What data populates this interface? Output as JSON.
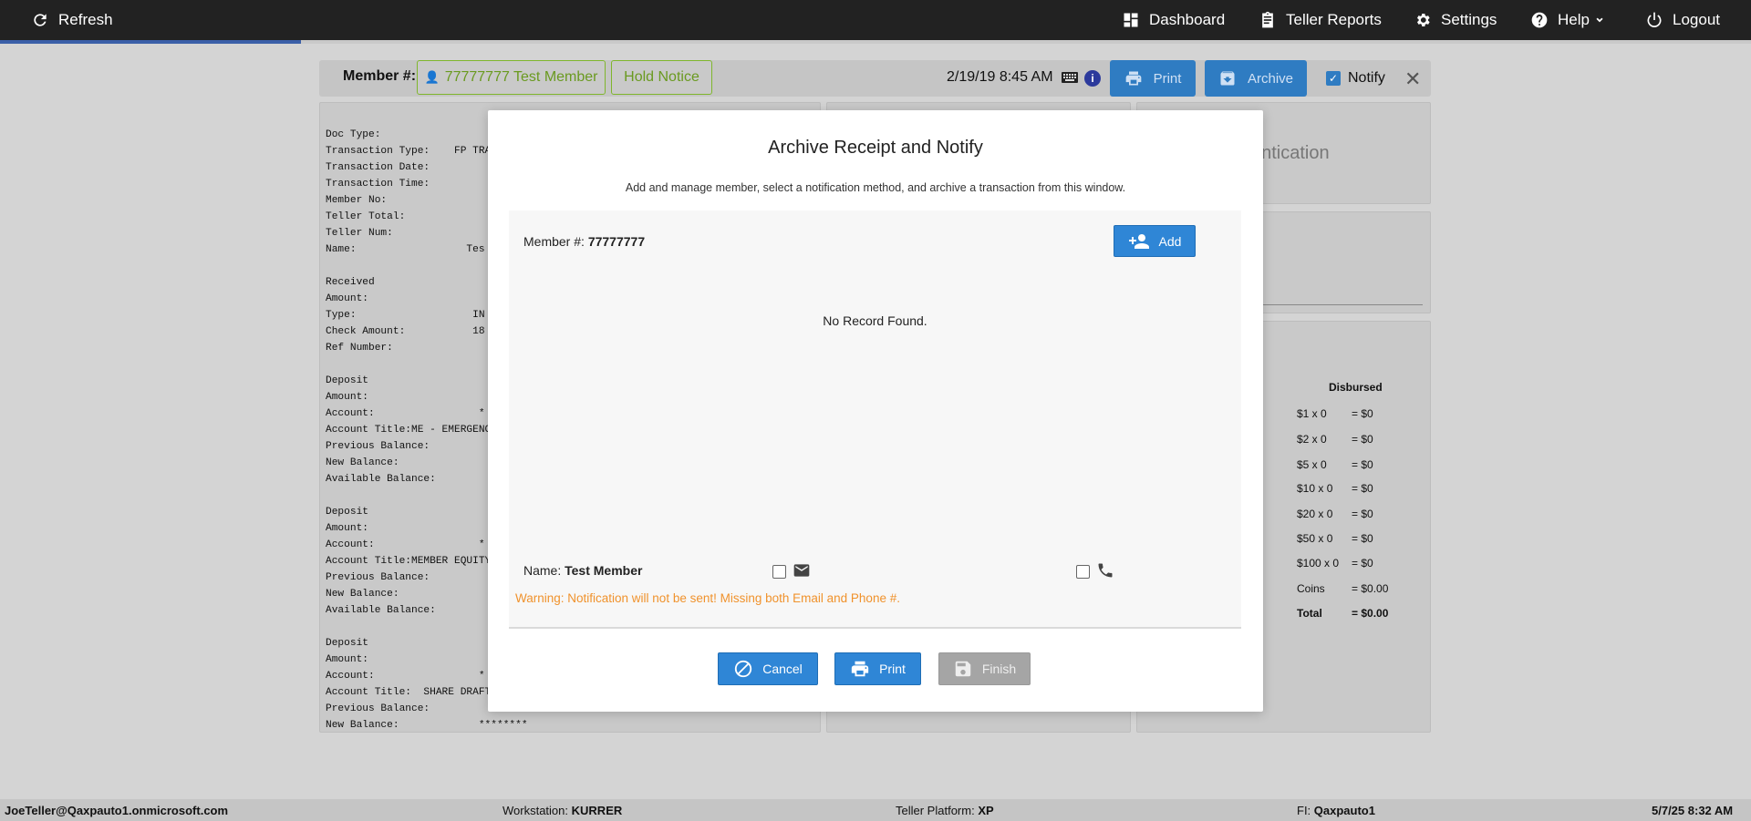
{
  "topbar": {
    "refresh_label": "Refresh",
    "dashboard_label": "Dashboard",
    "teller_reports_label": "Teller Reports",
    "settings_label": "Settings",
    "help_label": "Help",
    "logout_label": "Logout"
  },
  "page_header": {
    "member_label": "Member #:",
    "member_button": "77777777 Test Member",
    "hold_notice": "Hold Notice",
    "datetime": "2/19/19 8:45 AM",
    "info_label": "i",
    "print_label": "Print",
    "archive_label": "Archive",
    "notify_label": "Notify",
    "notify_checked": true
  },
  "receipt_lines": [
    "Doc Type:",
    "Transaction Type:    FP TRA",
    "Transaction Date:",
    "Transaction Time:",
    "Member No:",
    "Teller Total:",
    "Teller Num:",
    "Name:                  Tes",
    "",
    "Received",
    "Amount:",
    "Type:                   IN",
    "Check Amount:           18",
    "Ref Number:",
    "",
    "Deposit",
    "Amount:",
    "Account:                 *",
    "Account Title:ME - EMERGENC",
    "Previous Balance:",
    "New Balance:",
    "Available Balance:",
    "",
    "Deposit",
    "Amount:",
    "Account:                 *",
    "Account Title:MEMBER EQUITY",
    "Previous Balance:",
    "New Balance:",
    "Available Balance:",
    "",
    "Deposit",
    "Amount:",
    "Account:                 *",
    "Account Title:  SHARE DRAFT",
    "Previous Balance:",
    "New Balance:             ********"
  ],
  "right_panel": {
    "auth_fragment": "entication",
    "disbursed_title": "Disbursed",
    "rows": [
      {
        "denom": "$1 x 0",
        "total": "= $0"
      },
      {
        "denom": "$2 x 0",
        "total": "= $0"
      },
      {
        "denom": "$5 x 0",
        "total": "= $0"
      },
      {
        "denom": "$10 x 0",
        "total": "= $0"
      },
      {
        "denom": "$20 x 0",
        "total": "= $0"
      },
      {
        "denom": "$50 x 0",
        "total": "= $0"
      },
      {
        "denom": "$100 x 0",
        "total": "= $0"
      },
      {
        "denom": "Coins",
        "total": "= $0.00"
      },
      {
        "denom": "Total",
        "total": "= $0.00"
      }
    ]
  },
  "modal": {
    "title": "Archive Receipt and Notify",
    "subtitle": "Add and manage member, select a notification method, and archive a transaction from this window.",
    "member_label": "Member #:",
    "member_number": "77777777",
    "add_label": "Add",
    "no_record": "No Record Found.",
    "name_label": "Name:",
    "name_value": "Test Member",
    "warning": "Warning: Notification will not be sent! Missing both Email and Phone #.",
    "cancel_label": "Cancel",
    "print_label": "Print",
    "finish_label": "Finish"
  },
  "statusbar": {
    "user": "JoeTeller@Qaxpauto1.onmicrosoft.com",
    "workstation_label": "Workstation:",
    "workstation_value": "KURRER",
    "platform_label": "Teller Platform:",
    "platform_value": "XP",
    "fi_label": "FI:",
    "fi_value": "Qaxpauto1",
    "datetime": "5/7/25 8:32 AM"
  },
  "colors": {
    "accent_blue": "#2f86d6",
    "warning_orange": "#f0922c",
    "member_green": "#7fb62c",
    "topbar": "#222222"
  }
}
